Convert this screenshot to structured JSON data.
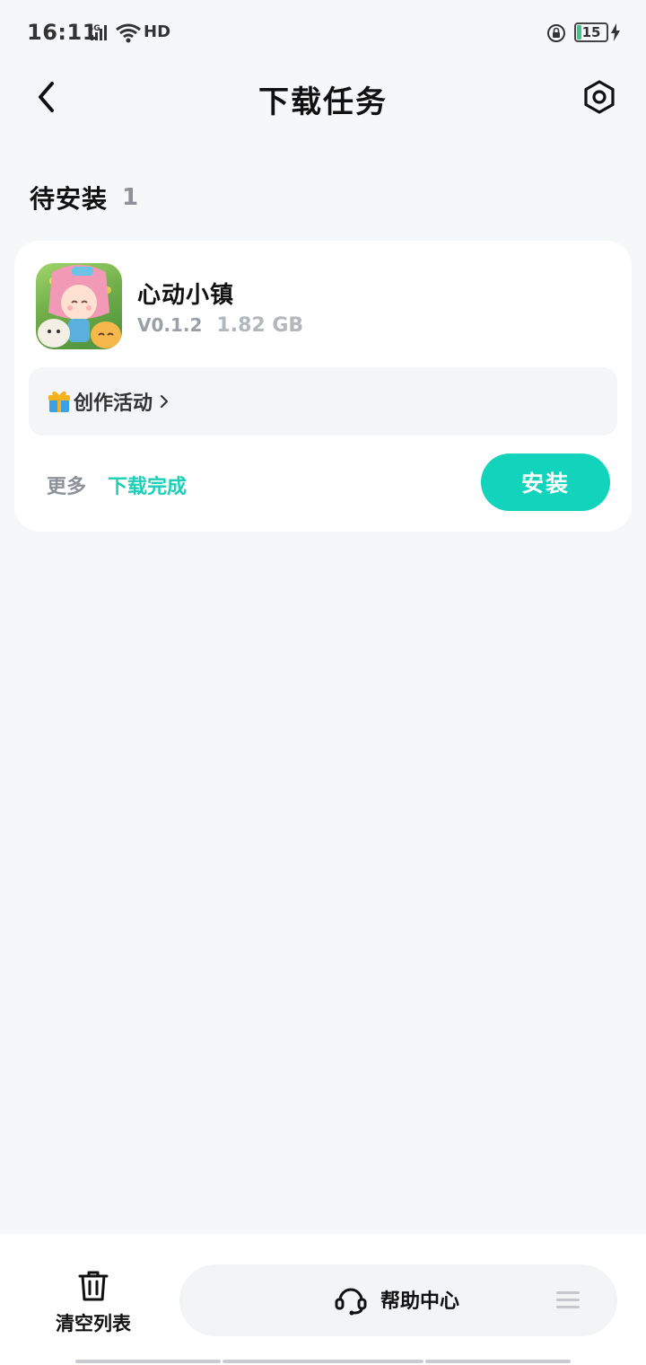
{
  "status_bar": {
    "time": "16:11",
    "network": "4G",
    "hd": "HD",
    "battery": "15"
  },
  "header": {
    "title": "下载任务",
    "back_icon": "chevron-left-icon",
    "settings_icon": "hexagon-gear-icon"
  },
  "section": {
    "title": "待安装",
    "count": "1"
  },
  "task": {
    "app_name": "心动小镇",
    "version": "V0.1.2",
    "size": "1.82  GB",
    "activity_label": "创作活动",
    "more_label": "更多",
    "status_label": "下载完成",
    "install_label": "安装"
  },
  "bottom_bar": {
    "clear_label": "清空列表",
    "help_label": "帮助中心"
  },
  "colors": {
    "accent": "#12d4bc",
    "status_green": "#1dcfb6",
    "background": "#f6f7f9",
    "muted_text": "#8d9299"
  }
}
